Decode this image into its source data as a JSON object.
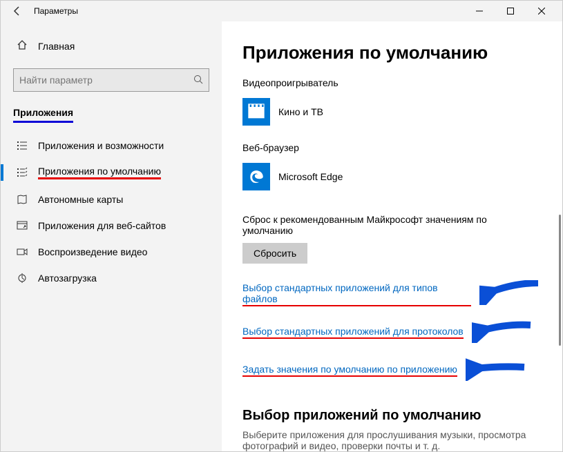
{
  "window": {
    "title": "Параметры"
  },
  "sidebar": {
    "home": "Главная",
    "search_placeholder": "Найти параметр",
    "section": "Приложения",
    "items": [
      {
        "label": "Приложения и возможности"
      },
      {
        "label": "Приложения по умолчанию"
      },
      {
        "label": "Автономные карты"
      },
      {
        "label": "Приложения для веб-сайтов"
      },
      {
        "label": "Воспроизведение видео"
      },
      {
        "label": "Автозагрузка"
      }
    ]
  },
  "main": {
    "heading": "Приложения по умолчанию",
    "video_label": "Видеопроигрыватель",
    "video_app": "Кино и ТВ",
    "browser_label": "Веб-браузер",
    "browser_app": "Microsoft Edge",
    "reset_desc": "Сброс к рекомендованным Майкрософт значениям по умолчанию",
    "reset_btn": "Сбросить",
    "link1": "Выбор стандартных приложений для типов файлов",
    "link2": "Выбор стандартных приложений для протоколов",
    "link3": "Задать значения по умолчанию по приложению",
    "section2_title": "Выбор приложений по умолчанию",
    "section2_desc": "Выберите приложения для прослушивания музыки, просмотра фотографий и видео, проверки почты и т. д."
  }
}
